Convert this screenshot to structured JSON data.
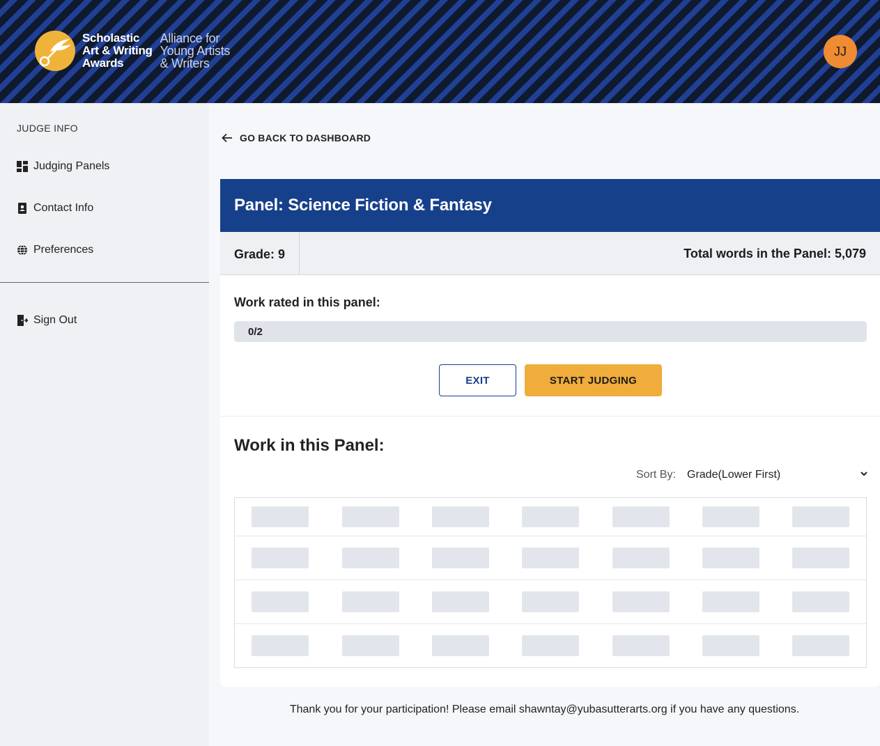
{
  "header": {
    "logo_line1": "Scholastic",
    "logo_line2": "Art & Writing",
    "logo_line3": "Awards",
    "alliance_line1": "Alliance for",
    "alliance_line2": "Young Artists",
    "alliance_line3": "& Writers",
    "avatar_initials": "JJ"
  },
  "sidebar": {
    "heading": "JUDGE INFO",
    "items": [
      {
        "label": "Judging Panels",
        "icon": "dashboard-grid-icon"
      },
      {
        "label": "Contact Info",
        "icon": "contact-card-icon"
      },
      {
        "label": "Preferences",
        "icon": "globe-settings-icon"
      }
    ],
    "sign_out": {
      "label": "Sign Out",
      "icon": "exit-door-icon"
    }
  },
  "main": {
    "back_label": "GO BACK TO DASHBOARD",
    "panel_title": "Panel: Science Fiction & Fantasy",
    "grade_text": "Grade: 9",
    "total_words_text": "Total words in the Panel: 5,079",
    "rated_label": "Work rated in this panel:",
    "progress": {
      "text": "0/2",
      "rated": 0,
      "total": 2
    },
    "exit_label": "EXIT",
    "start_label": "START JUDGING",
    "work_title": "Work in this Panel:",
    "sort_label": "Sort By:",
    "sort_value": "Grade(Lower First)",
    "footer": "Thank you for your participation! Please email shawntay@yubasutterarts.org if you have any questions."
  },
  "colors": {
    "brand_blue": "#17408b",
    "accent_yellow": "#f0ad3c",
    "avatar_orange": "#ee8b33"
  }
}
